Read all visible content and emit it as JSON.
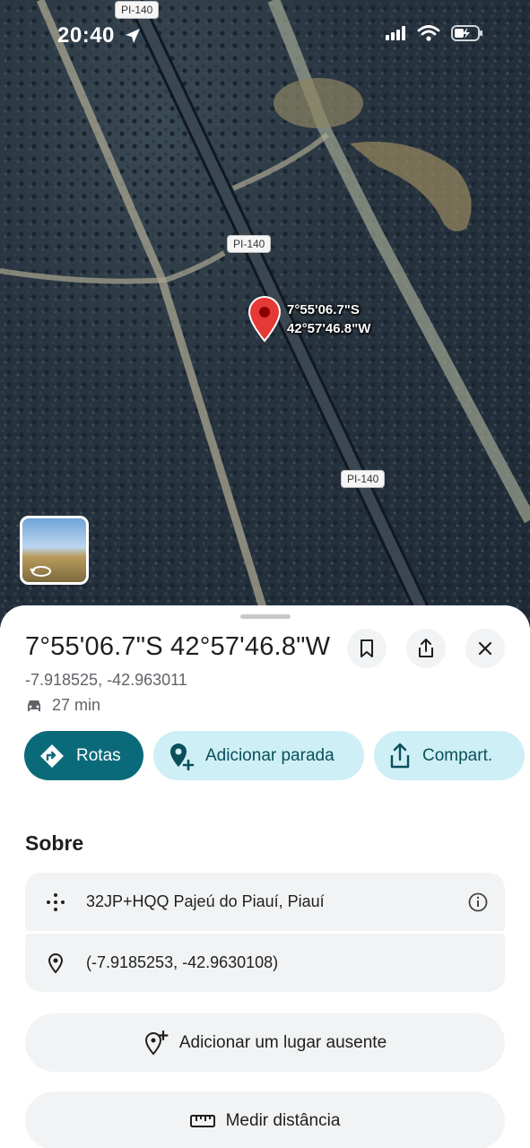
{
  "status_bar": {
    "time": "20:40"
  },
  "map": {
    "road_labels": [
      "PI-140",
      "PI-140",
      "PI-140"
    ],
    "pin_label_line1": "7°55'06.7\"S",
    "pin_label_line2": "42°57'46.8\"W"
  },
  "sheet": {
    "title": "7°55'06.7\"S 42°57'46.8\"W",
    "decimal_coords": "-7.918525, -42.963011",
    "drive_time": "27 min",
    "chips": {
      "directions": "Rotas",
      "add_stop": "Adicionar parada",
      "share": "Compart."
    },
    "section_title": "Sobre",
    "plus_code": "32JP+HQQ Pajeú do Piauí, Piauí",
    "precise_coords": "(-7.9185253, -42.9630108)",
    "add_missing_place": "Adicionar um lugar ausente",
    "measure_distance": "Medir distância"
  },
  "colors": {
    "primary_chip": "#0b6a7a",
    "secondary_chip": "#cdeff5",
    "pin": "#e53935"
  }
}
